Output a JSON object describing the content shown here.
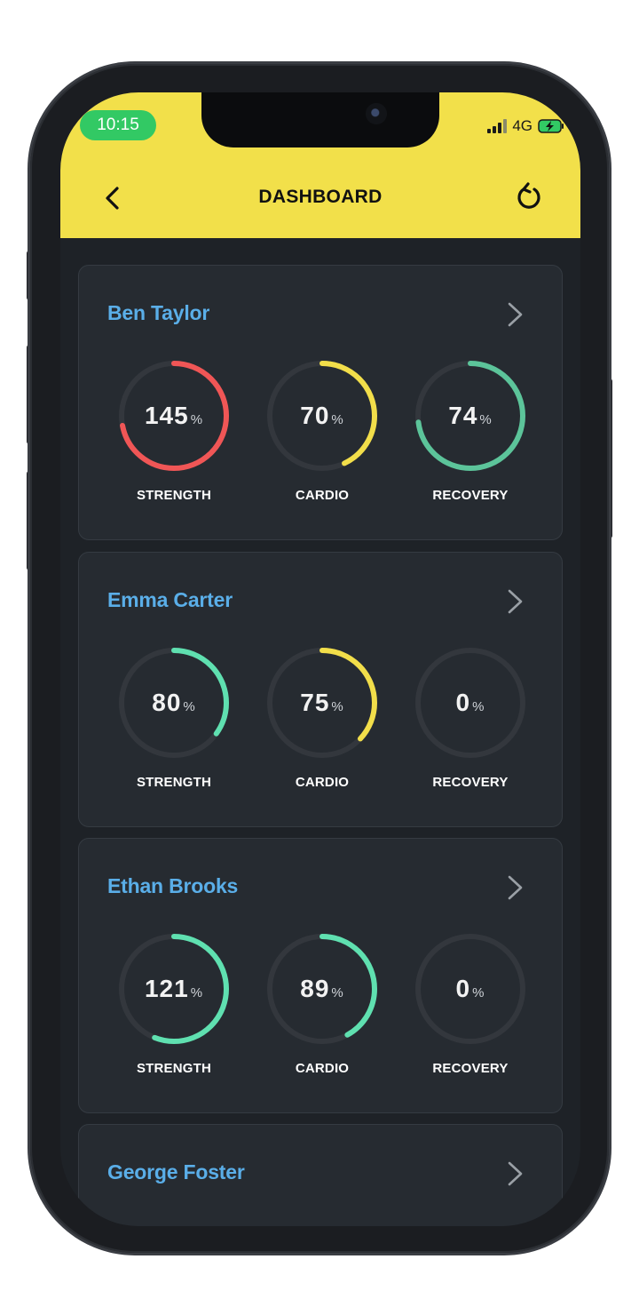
{
  "status": {
    "time": "10:15",
    "network": "4G"
  },
  "header": {
    "title": "DASHBOARD",
    "back_icon": "back-arrow-icon",
    "refresh_icon": "refresh-icon"
  },
  "colors": {
    "header_bg": "#f2e04a",
    "name": "#5aaee8",
    "red": "#f05656",
    "yellow": "#f2de4a",
    "green": "#5cc49a",
    "teal": "#5fe0b0",
    "track": "#33373d"
  },
  "cards": [
    {
      "name": "Ben Taylor",
      "metrics": [
        {
          "label": "STRENGTH",
          "value": "145",
          "unit": "%",
          "progress": 0.72,
          "color": "#f05656"
        },
        {
          "label": "CARDIO",
          "value": "70",
          "unit": "%",
          "progress": 0.43,
          "color": "#f2de4a"
        },
        {
          "label": "RECOVERY",
          "value": "74",
          "unit": "%",
          "progress": 0.73,
          "color": "#5cc49a"
        }
      ]
    },
    {
      "name": "Emma Carter",
      "metrics": [
        {
          "label": "STRENGTH",
          "value": "80",
          "unit": "%",
          "progress": 0.35,
          "color": "#5fe0b0"
        },
        {
          "label": "CARDIO",
          "value": "75",
          "unit": "%",
          "progress": 0.37,
          "color": "#f2de4a"
        },
        {
          "label": "RECOVERY",
          "value": "0",
          "unit": "%",
          "progress": 0,
          "color": "#5cc49a"
        }
      ]
    },
    {
      "name": "Ethan Brooks",
      "metrics": [
        {
          "label": "STRENGTH",
          "value": "121",
          "unit": "%",
          "progress": 0.56,
          "color": "#5fe0b0"
        },
        {
          "label": "CARDIO",
          "value": "89",
          "unit": "%",
          "progress": 0.42,
          "color": "#5fe0b0"
        },
        {
          "label": "RECOVERY",
          "value": "0",
          "unit": "%",
          "progress": 0,
          "color": "#5cc49a"
        }
      ]
    },
    {
      "name": "George Foster",
      "metrics": []
    }
  ]
}
